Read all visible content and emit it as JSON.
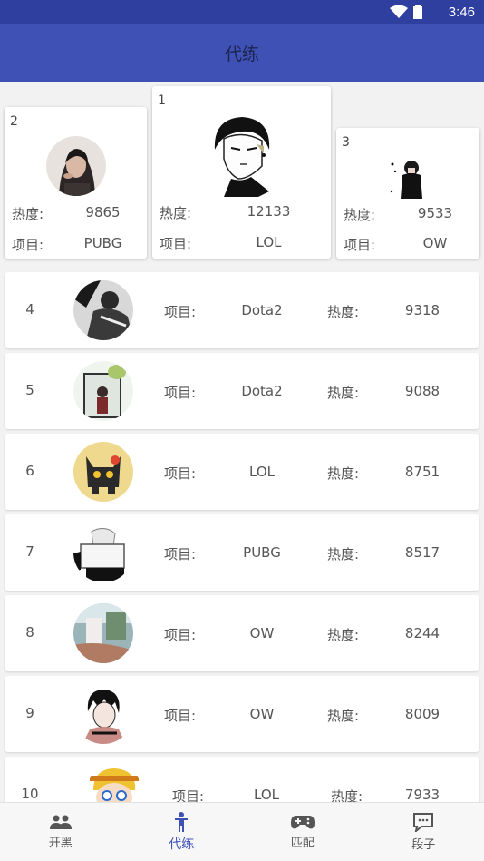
{
  "status_bar": {
    "time": "3:46",
    "icons": [
      "wifi-icon",
      "battery-icon"
    ]
  },
  "app_bar": {
    "title": "代练"
  },
  "labels": {
    "heat": "热度:",
    "game": "项目:"
  },
  "podium": [
    {
      "rank": "2",
      "heat": "9865",
      "game": "PUBG",
      "avatar": "avatar-woman"
    },
    {
      "rank": "1",
      "heat": "12133",
      "game": "LOL",
      "avatar": "avatar-anime-boy"
    },
    {
      "rank": "3",
      "heat": "9533",
      "game": "OW",
      "avatar": "avatar-small-figure"
    }
  ],
  "list": [
    {
      "rank": "4",
      "game": "Dota2",
      "heat": "9318"
    },
    {
      "rank": "5",
      "game": "Dota2",
      "heat": "9088"
    },
    {
      "rank": "6",
      "game": "LOL",
      "heat": "8751"
    },
    {
      "rank": "7",
      "game": "PUBG",
      "heat": "8517"
    },
    {
      "rank": "8",
      "game": "OW",
      "heat": "8244"
    },
    {
      "rank": "9",
      "game": "OW",
      "heat": "8009"
    },
    {
      "rank": "10",
      "game": "LOL",
      "heat": "7933"
    }
  ],
  "bottom_nav": [
    {
      "label": "开黑",
      "icon": "group-icon",
      "active": false
    },
    {
      "label": "代练",
      "icon": "person-icon",
      "active": true
    },
    {
      "label": "匹配",
      "icon": "gamepad-icon",
      "active": false
    },
    {
      "label": "段子",
      "icon": "chat-icon",
      "active": false
    }
  ],
  "colors": {
    "primary": "#3f51b5",
    "status_bar": "#2f3fa0",
    "active_nav": "#3f51b5"
  }
}
